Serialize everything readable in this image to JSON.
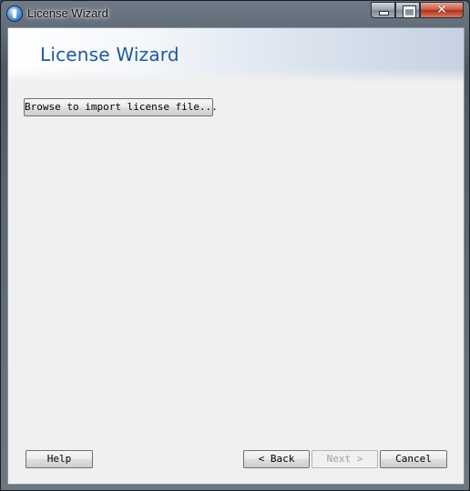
{
  "window": {
    "title": "License Wizard",
    "controls": {
      "minimize": "minimize-icon",
      "maximize": "maximize-icon",
      "close": "close-icon",
      "close_glyph": "✕"
    }
  },
  "wizard": {
    "header_title": "License Wizard",
    "browse_label": "Browse to import license file...",
    "buttons": {
      "help": "Help",
      "back": "< Back",
      "next": "Next >",
      "cancel": "Cancel"
    },
    "next_enabled": false
  },
  "colors": {
    "header_title": "#1e5aa0",
    "dialog_background": "#f0f0f0",
    "close_button": "#c75a43"
  }
}
